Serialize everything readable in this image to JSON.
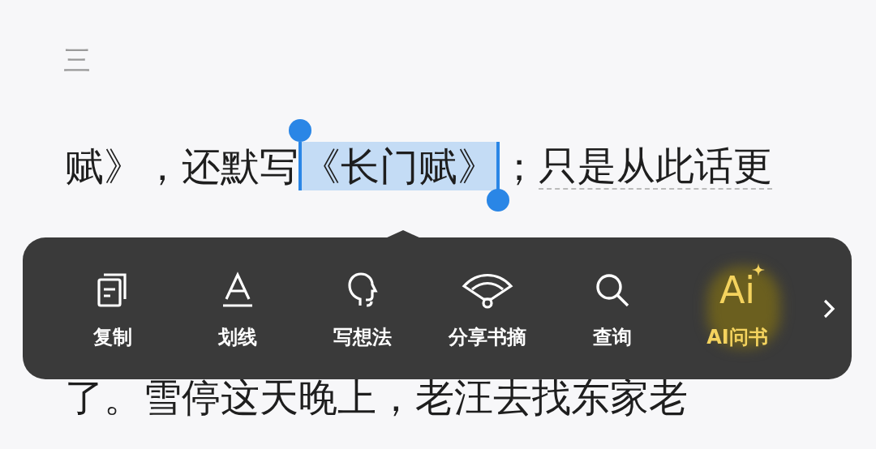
{
  "chapter_heading": "三",
  "lines": [
    {
      "segments": [
        {
          "text": "赋》，还默写",
          "kind": "plain"
        },
        {
          "text": "《长门赋》",
          "kind": "selected"
        },
        {
          "text": "；",
          "kind": "plain"
        },
        {
          "text": "只是从此话更",
          "kind": "underlined"
        }
      ]
    },
    {
      "segments": [
        {
          "text": "了。雪停这天晚上，老汪去找东家老",
          "kind": "plain"
        }
      ]
    }
  ],
  "menu": {
    "items": [
      {
        "kind": "copy",
        "label": "复制",
        "highlighted": false
      },
      {
        "kind": "underline",
        "label": "划线",
        "highlighted": false
      },
      {
        "kind": "thought",
        "label": "写想法",
        "highlighted": false
      },
      {
        "kind": "share",
        "label": "分享书摘",
        "highlighted": false
      },
      {
        "kind": "search",
        "label": "查询",
        "highlighted": false
      },
      {
        "kind": "ai",
        "glyph": "Ai",
        "label": "AI问书",
        "highlighted": true
      }
    ]
  }
}
